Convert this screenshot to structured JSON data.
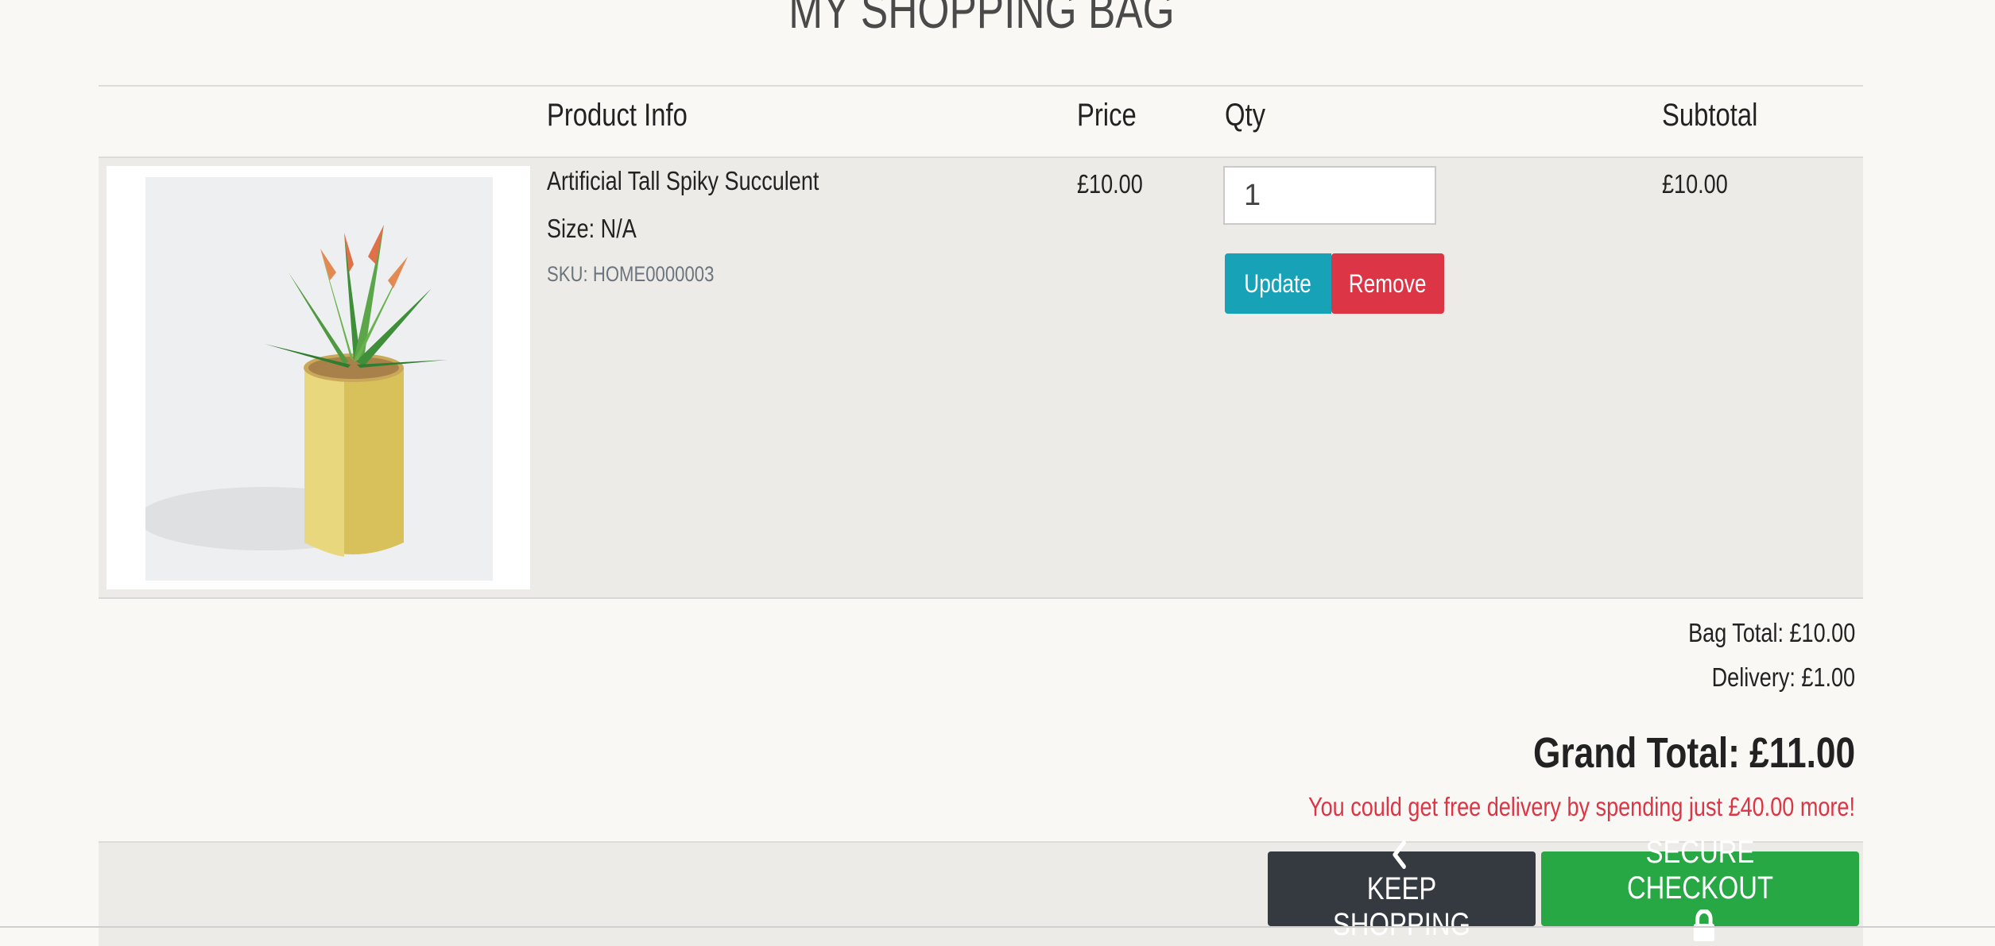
{
  "page": {
    "title": "MY SHOPPING BAG"
  },
  "table": {
    "headers": {
      "product_info": "Product Info",
      "price": "Price",
      "qty": "Qty",
      "subtotal": "Subtotal"
    },
    "items": [
      {
        "name": "Artificial Tall Spiky Succulent",
        "size": "Size: N/A",
        "sku": "SKU: HOME0000003",
        "price": "£10.00",
        "qty": "1",
        "subtotal": "£10.00",
        "image_icon": "succulent-plant-image",
        "update_label": "Update",
        "remove_label": "Remove"
      }
    ]
  },
  "totals": {
    "bag_total": "Bag Total: £10.00",
    "delivery": "Delivery: £1.00",
    "grand_total": "Grand Total: £11.00",
    "free_delivery_message": "You could get free delivery by spending just £40.00 more!"
  },
  "actions": {
    "keep_shopping": "KEEP SHOPPING",
    "secure_checkout": "SECURE CHECKOUT",
    "keep_shopping_icon": "chevron-left-icon",
    "checkout_icon": "lock-icon"
  },
  "colors": {
    "update": "#17a2b8",
    "remove": "#dc3545",
    "keep_shopping": "#343a40",
    "checkout": "#28a745",
    "warning_text": "#dc3545"
  }
}
